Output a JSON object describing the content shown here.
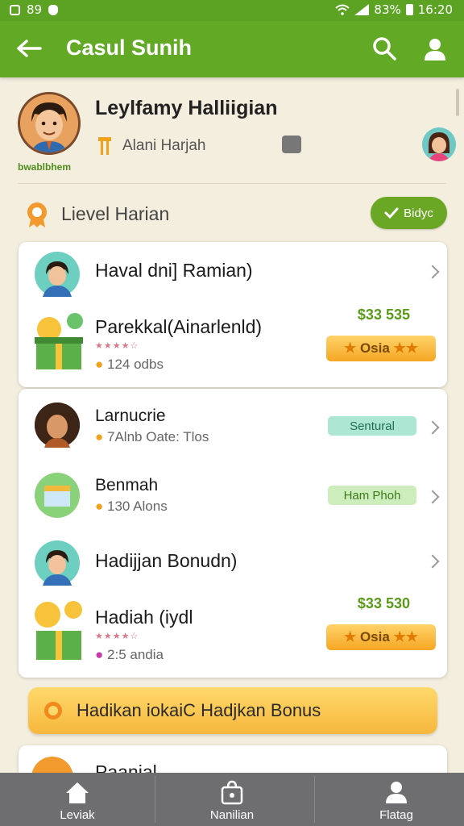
{
  "status": {
    "left_text": "89",
    "battery": "83%",
    "time": "16:20"
  },
  "appbar": {
    "title": "Casul Sunih",
    "back_icon": "back-arrow-icon",
    "search_icon": "search-icon",
    "user_icon": "user-icon"
  },
  "profile": {
    "name": "Leylfamy Halliigian",
    "tagline": "Alani Harjah",
    "sub_label": "bwablbhem"
  },
  "section": {
    "label": "Lievel Harian",
    "pill": "Bidyc"
  },
  "card1": {
    "row1": {
      "title": "Haval dni] Ramian)"
    },
    "row2": {
      "title": "Parekkal(Ainarlenld)",
      "price": "$33 535",
      "stars": "★★★★☆",
      "meta": "124 odbs",
      "badge": "Osia"
    }
  },
  "card2": {
    "row1": {
      "title": "Larnucrie",
      "meta": "7Alnb Oate: Tlos",
      "badge": "Sentural"
    },
    "row2": {
      "title": "Benmah",
      "meta": "130 Alons",
      "badge": "Ham Phoh"
    },
    "row3": {
      "title": "Hadijjan Bonudn)"
    },
    "row4": {
      "title": "Hadiah (iydl",
      "price": "$33 530",
      "stars": "★★★★☆",
      "meta": "2:5 andia",
      "badge": "Osia"
    }
  },
  "bonus": {
    "label": "Hadikan iokaiC Hadjkan Bonus"
  },
  "peek": {
    "title": "Paanial"
  },
  "bottomnav": {
    "tab1": "Leviak",
    "tab2": "Nanilian",
    "tab3": "Flatag"
  },
  "colors": {
    "primary": "#62aa26",
    "status_bar": "#5ca323",
    "gold": "#f5a623",
    "background": "#f4eedf"
  }
}
